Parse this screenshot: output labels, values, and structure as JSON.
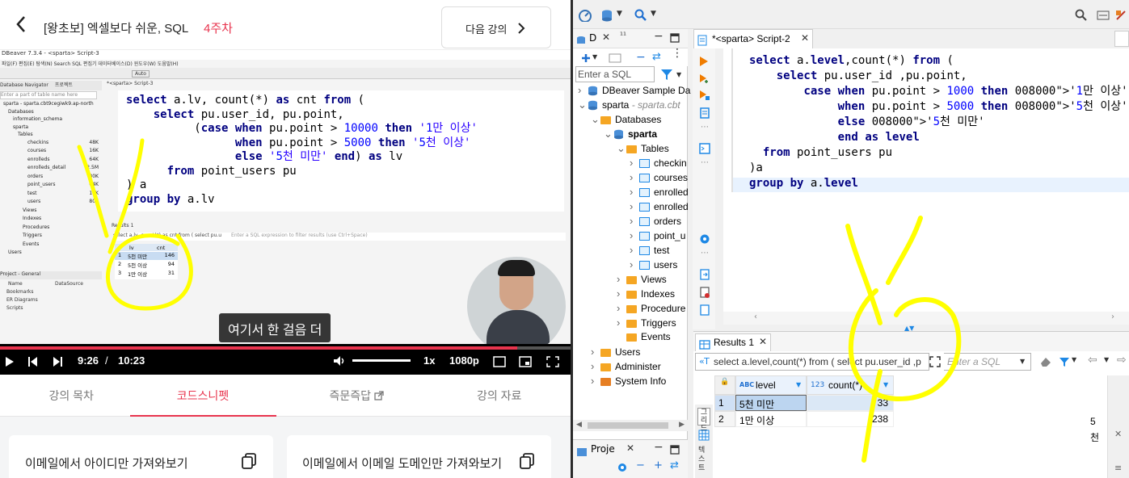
{
  "course_header": {
    "back_icon": "chevron-left-icon",
    "title": "[왕초보] 엑셀보다 쉬운, SQL",
    "week": "4주차",
    "next_label": "다음 강의",
    "accent_color": "#e8344e"
  },
  "video": {
    "dbeaver_title": "DBeaver 7.3.4 - <sparta> Script-3",
    "menu": "파일(F) 편집(E) 탐색(N) Search SQL 편집기 데이터베이스(D) 윈도우(W) 도움말(H)",
    "auto_label": "Auto",
    "nav_header": "Database Navigator",
    "nav_header2": "프로젝트",
    "nav_filter": "Enter a part of table name here",
    "nav_tree": [
      {
        "label": "sparta",
        "sub": "- sparta.cbt9cegiwk9.ap-north",
        "indent": 0
      },
      {
        "label": "Databases",
        "indent": 1
      },
      {
        "label": "information_schema",
        "indent": 2
      },
      {
        "label": "sparta",
        "indent": 2
      },
      {
        "label": "Tables",
        "indent": 3
      }
    ],
    "nav_tables": [
      {
        "name": "checkins",
        "size": "48K"
      },
      {
        "name": "courses",
        "size": "16K"
      },
      {
        "name": "enrolleds",
        "size": "64K"
      },
      {
        "name": "enrolleds_detail",
        "size": "2.5M"
      },
      {
        "name": "orders",
        "size": "80K"
      },
      {
        "name": "point_users",
        "size": "64K"
      },
      {
        "name": "test",
        "size": "16K"
      },
      {
        "name": "users",
        "size": "80K"
      }
    ],
    "nav_more": [
      "Views",
      "Indexes",
      "Procedures",
      "Triggers",
      "Events"
    ],
    "nav_users": "Users",
    "project_header": "Project - General",
    "project_cols": [
      "Name",
      "DataSource"
    ],
    "project_items": [
      "Bookmarks",
      "ER Diagrams",
      "Scripts"
    ],
    "script_tab": "*<sparta> Script-3",
    "code_lines": [
      "select a.lv, count(*) as cnt from (",
      "    select pu.user_id, pu.point,",
      "          (case when pu.point > 10000 then '1만 이상'",
      "                when pu.point > 5000 then '5천 이상'",
      "                else '5천 미만' end) as lv",
      "      from point_users pu",
      ") a",
      "group by a.lv"
    ],
    "results_tab": "Results 1",
    "filter_text": "select a.lv, count(*) as cnt from ( select pu.u",
    "filter_placeholder": "Enter a SQL expression to filter results (use Ctrl+Space)",
    "result_cols": [
      "lv",
      "cnt"
    ],
    "result_rows": [
      {
        "n": "1",
        "lv": "5천 미만",
        "cnt": "146"
      },
      {
        "n": "2",
        "lv": "5천 이상",
        "cnt": "94"
      },
      {
        "n": "3",
        "lv": "1만 이상",
        "cnt": "31"
      }
    ],
    "subtitle": "여기서 한 걸음 더",
    "time_current": "9:26",
    "time_sep": "/",
    "time_total": "10:23",
    "progress": 0.906,
    "speed": "1x",
    "quality": "1080p"
  },
  "lecture_tabs": [
    {
      "label": "강의 목차",
      "active": false
    },
    {
      "label": "코드스니펫",
      "active": true
    },
    {
      "label": "즉문즉답",
      "active": false,
      "external": true
    },
    {
      "label": "강의 자료",
      "active": false
    }
  ],
  "snippets": [
    {
      "title": "이메일에서 아이디만 가져와보기",
      "icon": "copy-icon"
    },
    {
      "title": "이메일에서 이메일 도메인만 가져와보기",
      "icon": "copy-icon"
    }
  ],
  "ide": {
    "nav_tab": "D",
    "nav_tab2": "¹¹",
    "filter_placeholder": "Enter a SQL",
    "tree": [
      {
        "label": "DBeaver Sample Da",
        "kind": "db",
        "indent": 0,
        "arrow": ">"
      },
      {
        "label": "sparta",
        "sub": "- sparta.cbt",
        "kind": "db",
        "indent": 0,
        "arrow": "v"
      },
      {
        "label": "Databases",
        "kind": "folder",
        "indent": 1,
        "arrow": "v"
      },
      {
        "label": "sparta",
        "kind": "db",
        "indent": 2,
        "arrow": "v",
        "bold": true
      },
      {
        "label": "Tables",
        "kind": "folder",
        "indent": 3,
        "arrow": "v"
      },
      {
        "label": "checkin",
        "kind": "table",
        "indent": 4,
        "arrow": ">"
      },
      {
        "label": "courses",
        "kind": "table",
        "indent": 4,
        "arrow": ">"
      },
      {
        "label": "enrolled",
        "kind": "table",
        "indent": 4,
        "arrow": ">"
      },
      {
        "label": "enrolled",
        "kind": "table",
        "indent": 4,
        "arrow": ">"
      },
      {
        "label": "orders",
        "kind": "table",
        "indent": 4,
        "arrow": ">"
      },
      {
        "label": "point_u",
        "kind": "table",
        "indent": 4,
        "arrow": ">"
      },
      {
        "label": "test",
        "kind": "table",
        "indent": 4,
        "arrow": ">"
      },
      {
        "label": "users",
        "kind": "table",
        "indent": 4,
        "arrow": ">"
      },
      {
        "label": "Views",
        "kind": "folder",
        "indent": 3,
        "arrow": ">"
      },
      {
        "label": "Indexes",
        "kind": "folder",
        "indent": 3,
        "arrow": ">"
      },
      {
        "label": "Procedure",
        "kind": "folder",
        "indent": 3,
        "arrow": ">"
      },
      {
        "label": "Triggers",
        "kind": "folder",
        "indent": 3,
        "arrow": ">"
      },
      {
        "label": "Events",
        "kind": "folder",
        "indent": 3,
        "arrow": ""
      },
      {
        "label": "Users",
        "kind": "folder",
        "indent": 1,
        "arrow": ">"
      },
      {
        "label": "Administer",
        "kind": "folder",
        "indent": 1,
        "arrow": ">"
      },
      {
        "label": "System Info",
        "kind": "info",
        "indent": 1,
        "arrow": ">"
      }
    ],
    "project_tab": "Proje",
    "editor_tab": "*<sparta> Script-2",
    "code_lines": [
      "select a.level,count(*) from (",
      "    select pu.user_id ,pu.point,",
      "        case when pu.point > 1000 then '1만 이상'",
      "             when pu.point > 5000 then '5천 이상'",
      "             else '5천 미만'",
      "             end as level",
      "  from point_users pu",
      ")a",
      "group by a.level"
    ],
    "results_tab": "Results 1",
    "filter_text": "select a.level,count(*) from ( select pu.user_id ,p",
    "side_label1": "그리드",
    "side_label2": "텍스트",
    "col_level": "level",
    "col_count": "count(*)",
    "col_level_type": "ABC",
    "col_count_type": "123",
    "rows": [
      {
        "n": "1",
        "level": "5천 미만",
        "count": "33"
      },
      {
        "n": "2",
        "level": "1만 이상",
        "count": "238"
      }
    ],
    "right_edge_digit": "5",
    "right_edge_char": "천"
  }
}
